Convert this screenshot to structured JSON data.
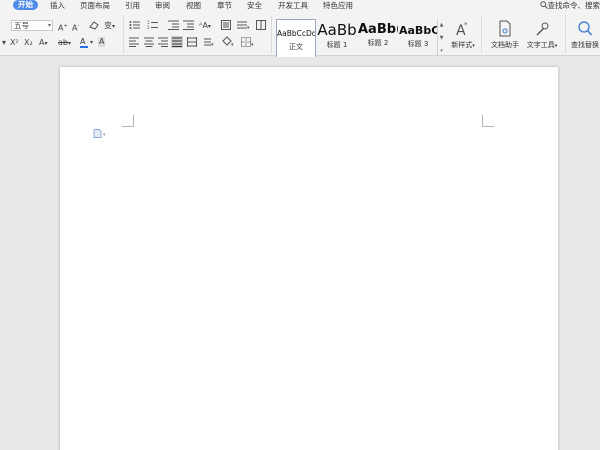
{
  "menu": {
    "items": [
      "开始",
      "插入",
      "页面布局",
      "引用",
      "审阅",
      "视图",
      "章节",
      "安全",
      "开发工具",
      "特色应用"
    ],
    "search": "查找命令、搜索"
  },
  "ribbon": {
    "font_size": "五号",
    "styles": [
      {
        "sample": "AaBbCcDd",
        "name": "正文"
      },
      {
        "sample": "AaBb",
        "name": "标题 1"
      },
      {
        "sample": "AaBb(",
        "name": "标题 2"
      },
      {
        "sample": "AaBbC(",
        "name": "标题 3"
      }
    ],
    "new_style": "新样式",
    "doc_assistant": "文档助手",
    "text_tools": "文字工具",
    "find_replace": "查找替换"
  },
  "colors": {
    "active_tab": "#4f8be8",
    "font_color_a": "#2b6de0",
    "highlight": "#f2e34a"
  }
}
